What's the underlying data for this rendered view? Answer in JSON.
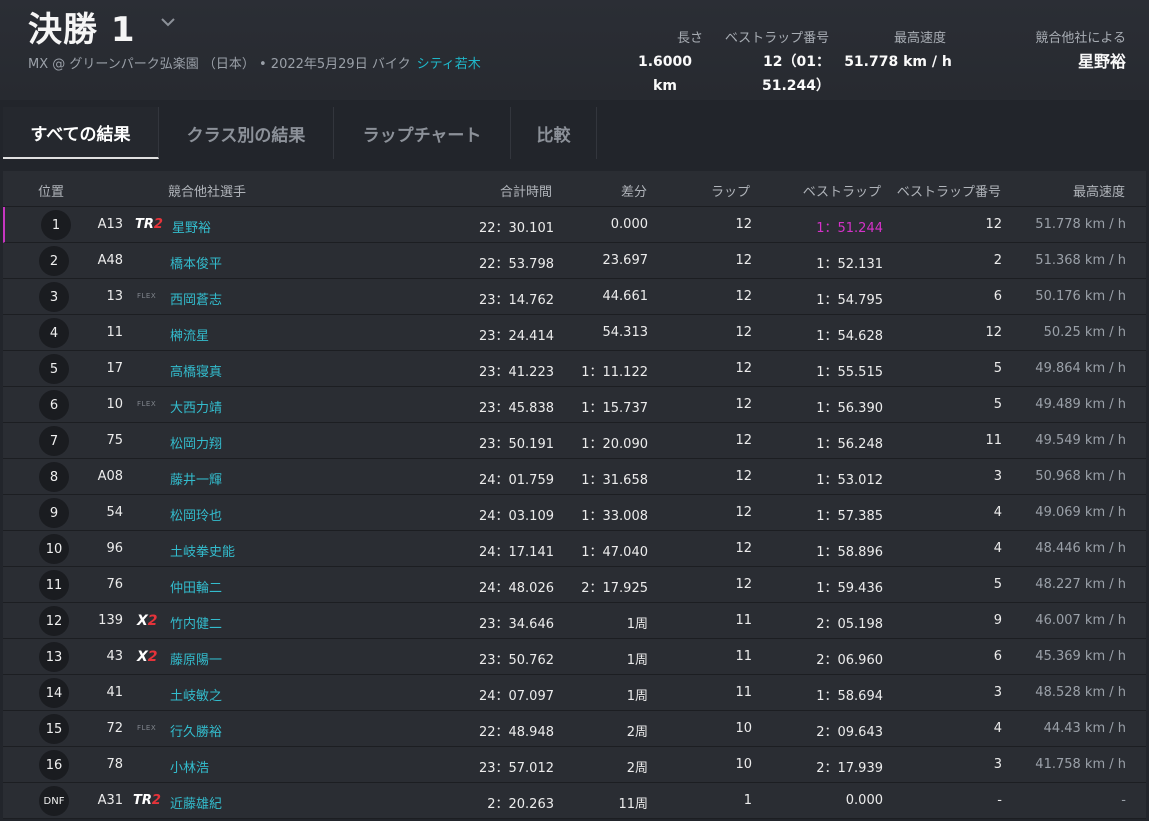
{
  "header": {
    "title": "決勝 1",
    "subtitle": "MX @ グリーンパーク弘楽園 （日本） • 2022年5月29日 バイク",
    "subtitle_link": "シティ若木",
    "stats": [
      {
        "label": "長さ",
        "value": "1.6000 km"
      },
      {
        "label": "ベストラップ番号",
        "value_line1": "12（01：",
        "value_line2": "51.244）"
      },
      {
        "label": "最高速度",
        "value": "51.778 km / h"
      },
      {
        "label": "競合他社による",
        "value": "星野裕"
      }
    ]
  },
  "tabs": [
    "すべての結果",
    "クラス別の結果",
    "ラップチャート",
    "比較"
  ],
  "columns": {
    "position": "位置",
    "competitor": "競合他社選手",
    "total_time": "合計時間",
    "diff": "差分",
    "laps": "ラップ",
    "best_lap": "ベストラップ",
    "best_lap_no": "ベストラップ番号",
    "top_speed": "最高速度"
  },
  "rows": [
    {
      "pos": "1",
      "num": "A13",
      "tag": "TR2",
      "name": "星野裕",
      "total": "22：30.101",
      "diff": "0.000",
      "laps": "12",
      "best": "1：51.244",
      "best_no": "12",
      "speed": "51.778 km / h",
      "fastest": true
    },
    {
      "pos": "2",
      "num": "A48",
      "tag": "",
      "name": "橋本俊平",
      "total": "22：53.798",
      "diff": "23.697",
      "laps": "12",
      "best": "1：52.131",
      "best_no": "2",
      "speed": "51.368 km / h"
    },
    {
      "pos": "3",
      "num": "13",
      "tag": "FLEX",
      "name": "西岡蒼志",
      "total": "23：14.762",
      "diff": "44.661",
      "laps": "12",
      "best": "1：54.795",
      "best_no": "6",
      "speed": "50.176 km / h"
    },
    {
      "pos": "4",
      "num": "11",
      "tag": "",
      "name": "榊流星",
      "total": "23：24.414",
      "diff": "54.313",
      "laps": "12",
      "best": "1：54.628",
      "best_no": "12",
      "speed": "50.25 km / h"
    },
    {
      "pos": "5",
      "num": "17",
      "tag": "",
      "name": "高橋寝真",
      "total": "23：41.223",
      "diff": "1：11.122",
      "laps": "12",
      "best": "1：55.515",
      "best_no": "5",
      "speed": "49.864 km / h"
    },
    {
      "pos": "6",
      "num": "10",
      "tag": "FLEX",
      "name": "大西力靖",
      "total": "23：45.838",
      "diff": "1：15.737",
      "laps": "12",
      "best": "1：56.390",
      "best_no": "5",
      "speed": "49.489 km / h"
    },
    {
      "pos": "7",
      "num": "75",
      "tag": "",
      "name": "松岡力翔",
      "total": "23：50.191",
      "diff": "1：20.090",
      "laps": "12",
      "best": "1：56.248",
      "best_no": "11",
      "speed": "49.549 km / h"
    },
    {
      "pos": "8",
      "num": "A08",
      "tag": "",
      "name": "藤井一輝",
      "total": "24：01.759",
      "diff": "1：31.658",
      "laps": "12",
      "best": "1：53.012",
      "best_no": "3",
      "speed": "50.968 km / h"
    },
    {
      "pos": "9",
      "num": "54",
      "tag": "",
      "name": "松岡玲也",
      "total": "24：03.109",
      "diff": "1：33.008",
      "laps": "12",
      "best": "1：57.385",
      "best_no": "4",
      "speed": "49.069 km / h"
    },
    {
      "pos": "10",
      "num": "96",
      "tag": "",
      "name": "土岐拳史能",
      "total": "24：17.141",
      "diff": "1：47.040",
      "laps": "12",
      "best": "1：58.896",
      "best_no": "4",
      "speed": "48.446 km / h"
    },
    {
      "pos": "11",
      "num": "76",
      "tag": "",
      "name": "仲田輪二",
      "total": "24：48.026",
      "diff": "2：17.925",
      "laps": "12",
      "best": "1：59.436",
      "best_no": "5",
      "speed": "48.227 km / h"
    },
    {
      "pos": "12",
      "num": "139",
      "tag": "X2",
      "name": "竹内健二",
      "total": "23：34.646",
      "diff": "1周",
      "laps": "11",
      "best": "2：05.198",
      "best_no": "9",
      "speed": "46.007 km / h"
    },
    {
      "pos": "13",
      "num": "43",
      "tag": "X2",
      "name": "藤原陽一",
      "total": "23：50.762",
      "diff": "1周",
      "laps": "11",
      "best": "2：06.960",
      "best_no": "6",
      "speed": "45.369 km / h"
    },
    {
      "pos": "14",
      "num": "41",
      "tag": "",
      "name": "土岐敏之",
      "total": "24：07.097",
      "diff": "1周",
      "laps": "11",
      "best": "1：58.694",
      "best_no": "3",
      "speed": "48.528 km / h"
    },
    {
      "pos": "15",
      "num": "72",
      "tag": "FLEX",
      "name": "行久勝裕",
      "total": "22：48.948",
      "diff": "2周",
      "laps": "10",
      "best": "2：09.643",
      "best_no": "4",
      "speed": "44.43 km / h"
    },
    {
      "pos": "16",
      "num": "78",
      "tag": "",
      "name": "小林浩",
      "total": "23：57.012",
      "diff": "2周",
      "laps": "10",
      "best": "2：17.939",
      "best_no": "3",
      "speed": "41.758 km / h"
    },
    {
      "pos": "DNF",
      "num": "A31",
      "tag": "TR2",
      "name": "近藤雄紀",
      "total": "2：20.263",
      "diff": "11周",
      "laps": "1",
      "best": "0.000",
      "best_no": "-",
      "speed": "-"
    }
  ],
  "colors": {
    "accent_link": "#1fb6c8",
    "fastest_lap": "#d531c9",
    "leader_marker": "#c636c1",
    "background": "#22252b"
  }
}
